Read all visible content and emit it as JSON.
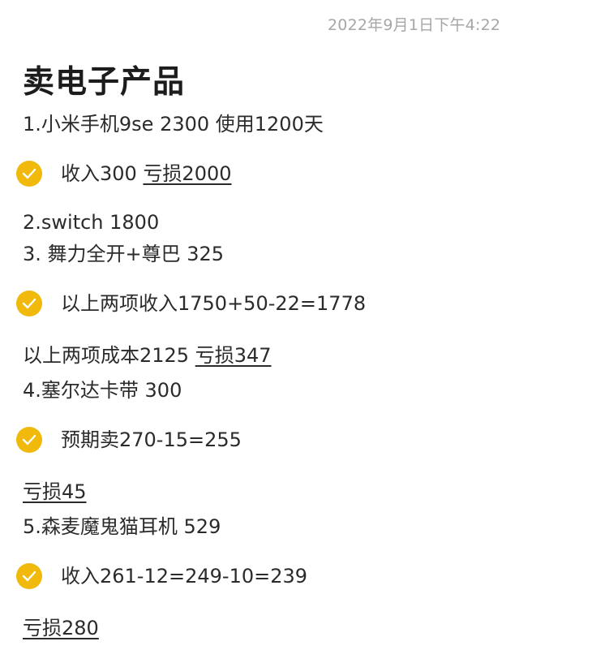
{
  "note": {
    "timestamp": "2022年9月1日下午4:22",
    "title": "卖电子产品",
    "lines": [
      "1.小米手机9se 2300 使用1200天",
      "2.switch 1800",
      "3. 舞力全开+尊巴 325",
      "4.塞尔达卡带 300",
      "5.森麦魔鬼猫耳机 529"
    ],
    "checks": [
      {
        "text": "收入300 ",
        "underlined": "亏损2000",
        "checked": true
      },
      {
        "text": "以上两项收入1750+50-22=1778",
        "checked": true
      },
      {
        "text": "预期卖270-15=255",
        "checked": true
      },
      {
        "text": "收入261-12=249-10=239",
        "checked": true
      }
    ],
    "cost_line": {
      "text": "以上两项成本2125 ",
      "underlined": "亏损347"
    },
    "loss_lines": [
      "亏损45",
      "亏损280"
    ]
  },
  "colors": {
    "accent": "#f0b90b",
    "text": "#2b2b2b",
    "meta": "#a6a6a6"
  }
}
